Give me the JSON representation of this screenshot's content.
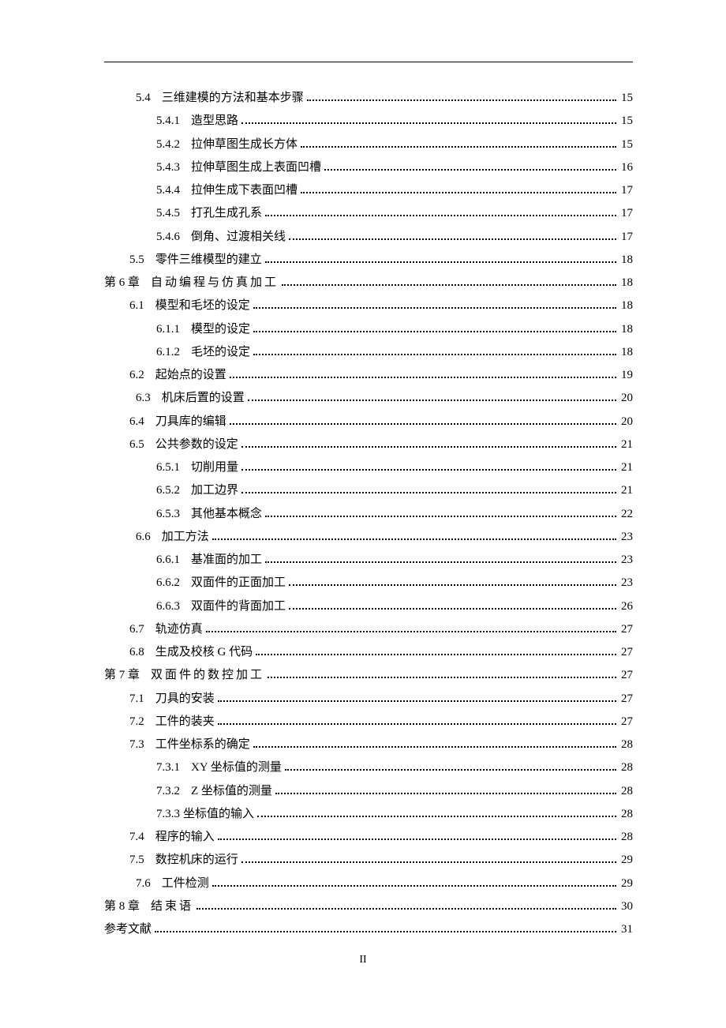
{
  "footer": "II",
  "entries": [
    {
      "level": "sec",
      "num": "5.4",
      "title": "三维建模的方法和基本步骤",
      "page": "15",
      "numSpaced": false,
      "titleSpaced": false,
      "extraIndent": 8
    },
    {
      "level": "sub",
      "num": "5.4.1",
      "title": "造型思路",
      "page": "15"
    },
    {
      "level": "sub",
      "num": "5.4.2",
      "title": "拉伸草图生成长方体",
      "page": "15"
    },
    {
      "level": "sub",
      "num": "5.4.3",
      "title": "拉伸草图生成上表面凹槽",
      "page": "16"
    },
    {
      "level": "sub",
      "num": "5.4.4",
      "title": "拉伸生成下表面凹槽",
      "page": "17"
    },
    {
      "level": "sub",
      "num": "5.4.5",
      "title": "打孔生成孔系",
      "page": "17"
    },
    {
      "level": "sub",
      "num": "5.4.6",
      "title": "倒角、过渡相关线",
      "page": "17"
    },
    {
      "level": "sec",
      "num": "5.5",
      "title": "零件三维模型的建立",
      "page": "18"
    },
    {
      "level": "chap",
      "num": "第 6 章",
      "title": "自动编程与仿真加工",
      "page": "18",
      "titleSpaced": true
    },
    {
      "level": "sec",
      "num": "6.1",
      "title": "模型和毛坯的设定",
      "page": "18"
    },
    {
      "level": "sub",
      "num": "6.1.1",
      "title": "模型的设定",
      "page": "18"
    },
    {
      "level": "sub",
      "num": "6.1.2",
      "title": "毛坯的设定",
      "page": "18"
    },
    {
      "level": "sec",
      "num": "6.2",
      "title": "起始点的设置",
      "page": "19"
    },
    {
      "level": "sec",
      "num": "6.3",
      "title": "机床后置的设置",
      "page": "20",
      "extraIndent": 8
    },
    {
      "level": "sec",
      "num": "6.4",
      "title": "刀具库的编辑",
      "page": "20"
    },
    {
      "level": "sec",
      "num": "6.5",
      "title": "公共参数的设定",
      "page": "21"
    },
    {
      "level": "sub",
      "num": "6.5.1",
      "title": "切削用量",
      "page": "21"
    },
    {
      "level": "sub",
      "num": "6.5.2",
      "title": "加工边界",
      "page": "21"
    },
    {
      "level": "sub",
      "num": "6.5.3",
      "title": "其他基本概念",
      "page": "22"
    },
    {
      "level": "sec",
      "num": "6.6",
      "title": "加工方法",
      "page": "23",
      "extraIndent": 8
    },
    {
      "level": "sub",
      "num": "6.6.1",
      "title": "基准面的加工",
      "page": "23"
    },
    {
      "level": "sub",
      "num": "6.6.2",
      "title": "双面件的正面加工",
      "page": "23"
    },
    {
      "level": "sub",
      "num": "6.6.3",
      "title": "双面件的背面加工",
      "page": "26"
    },
    {
      "level": "sec",
      "num": "6.7",
      "title": "轨迹仿真",
      "page": "27"
    },
    {
      "level": "sec",
      "num": "6.8",
      "title": "生成及校核 G 代码",
      "page": "27"
    },
    {
      "level": "chap",
      "num": "第 7 章",
      "title": "双面件的数控加工",
      "page": "27",
      "titleSpaced": true
    },
    {
      "level": "sec",
      "num": "7.1",
      "title": "刀具的安装",
      "page": "27"
    },
    {
      "level": "sec",
      "num": "7.2",
      "title": "工件的装夹",
      "page": "27"
    },
    {
      "level": "sec",
      "num": "7.3",
      "title": "工件坐标系的确定",
      "page": "28"
    },
    {
      "level": "sub",
      "num": "7.3.1",
      "title": "XY 坐标值的测量",
      "page": "28"
    },
    {
      "level": "sub",
      "num": "7.3.2",
      "title": "Z 坐标值的测量",
      "page": "28"
    },
    {
      "level": "sub",
      "num": "7.3.3",
      "title": "坐标值的输入",
      "page": "28",
      "numGap": 4
    },
    {
      "level": "sec",
      "num": "7.4",
      "title": "程序的输入",
      "page": "28"
    },
    {
      "level": "sec",
      "num": "7.5",
      "title": "数控机床的运行",
      "page": "29"
    },
    {
      "level": "sec",
      "num": "7.6",
      "title": "工件检测",
      "page": "29",
      "extraIndent": 8
    },
    {
      "level": "chap",
      "num": "第 8 章",
      "title": "结束语",
      "page": "30",
      "titleSpaced": true
    },
    {
      "level": "ref",
      "num": "",
      "title": "参考文献",
      "page": "31"
    }
  ]
}
